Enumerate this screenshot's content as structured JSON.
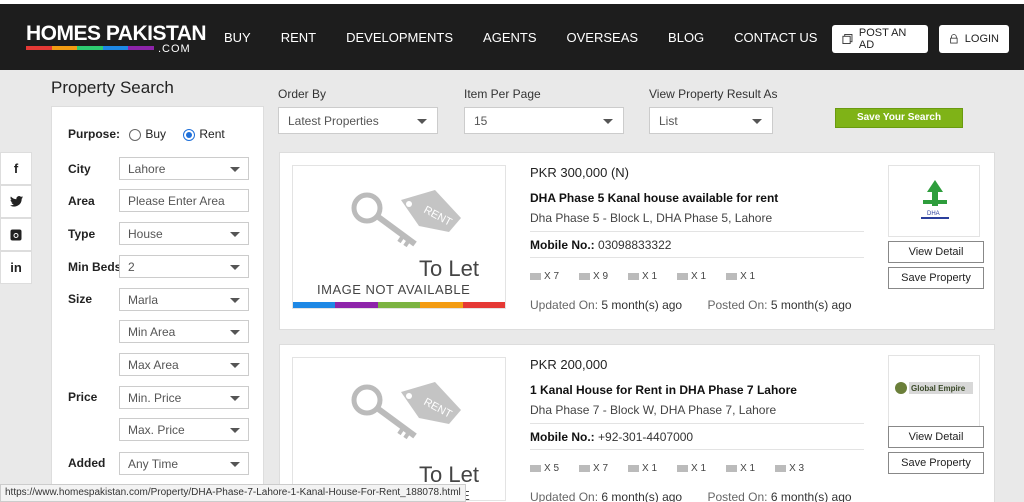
{
  "brand": {
    "name_main": "HOMES PAKISTAN",
    "name_sub": ".COM",
    "stripe_colors": [
      "#e53935",
      "#f39c12",
      "#2ecc71",
      "#1e88e5",
      "#8e24aa"
    ]
  },
  "nav": [
    "BUY",
    "RENT",
    "DEVELOPMENTS",
    "AGENTS",
    "OVERSEAS",
    "BLOG",
    "CONTACT US"
  ],
  "header_buttons": {
    "post_ad": "POST AN AD",
    "login": "LOGIN"
  },
  "sidebar": {
    "title": "Property Search",
    "purpose_label": "Purpose:",
    "purpose_options": [
      "Buy",
      "Rent"
    ],
    "purpose_selected": "Rent",
    "fields": [
      {
        "label": "City",
        "value": "Lahore",
        "type": "select"
      },
      {
        "label": "Area",
        "value": "Please Enter Area",
        "type": "input"
      },
      {
        "label": "Type",
        "value": "House",
        "type": "select"
      },
      {
        "label": "Min Beds",
        "value": "2",
        "type": "select"
      },
      {
        "label": "Size",
        "value": "Marla",
        "type": "select"
      },
      {
        "label": "",
        "value": "Min Area",
        "type": "select"
      },
      {
        "label": "",
        "value": "Max Area",
        "type": "select"
      },
      {
        "label": "Price",
        "value": "Min. Price",
        "type": "select"
      },
      {
        "label": "",
        "value": "Max. Price",
        "type": "select"
      },
      {
        "label": "Added",
        "value": "Any Time",
        "type": "select"
      }
    ]
  },
  "social": [
    "f",
    "t",
    "ig",
    "in"
  ],
  "toolbar": {
    "order_by_label": "Order By",
    "order_by_value": "Latest Properties",
    "per_page_label": "Item Per Page",
    "per_page_value": "15",
    "view_as_label": "View Property Result As",
    "view_as_value": "List",
    "save_search": "Save Your Search"
  },
  "listing_common": {
    "to_let": "To Let",
    "no_image": "IMAGE NOT AVAILABLE",
    "rent_tag": "RENT",
    "mobile_label": "Mobile No.:",
    "updated_label": "Updated On:",
    "posted_label": "Posted On:",
    "view_detail": "View Detail",
    "save_property": "Save Property"
  },
  "listings": [
    {
      "price": "PKR 300,000 (N)",
      "title": "DHA Phase 5 Kanal house available for rent",
      "location": "Dha Phase 5 - Block L, DHA Phase 5, Lahore",
      "mobile": "03098833322",
      "features": [
        "X 7",
        "X 9",
        "X 1",
        "X 1",
        "X 1"
      ],
      "updated": "5 month(s) ago",
      "posted": "5 month(s) ago",
      "agent_logo_text": "DHA"
    },
    {
      "price": "PKR 200,000",
      "title": "1 Kanal House for Rent in DHA Phase 7 Lahore",
      "location": "Dha Phase 7 - Block W, DHA Phase 7, Lahore",
      "mobile": "+92-301-4407000",
      "features": [
        "X 5",
        "X 7",
        "X 1",
        "X 1",
        "X 1",
        "X 3"
      ],
      "updated": "6 month(s) ago",
      "posted": "6 month(s) ago",
      "agent_logo_text": "Global Empire"
    }
  ],
  "status_url": "https://www.homespakistan.com/Property/DHA-Phase-7-Lahore-1-Kanal-House-For-Rent_188078.html"
}
